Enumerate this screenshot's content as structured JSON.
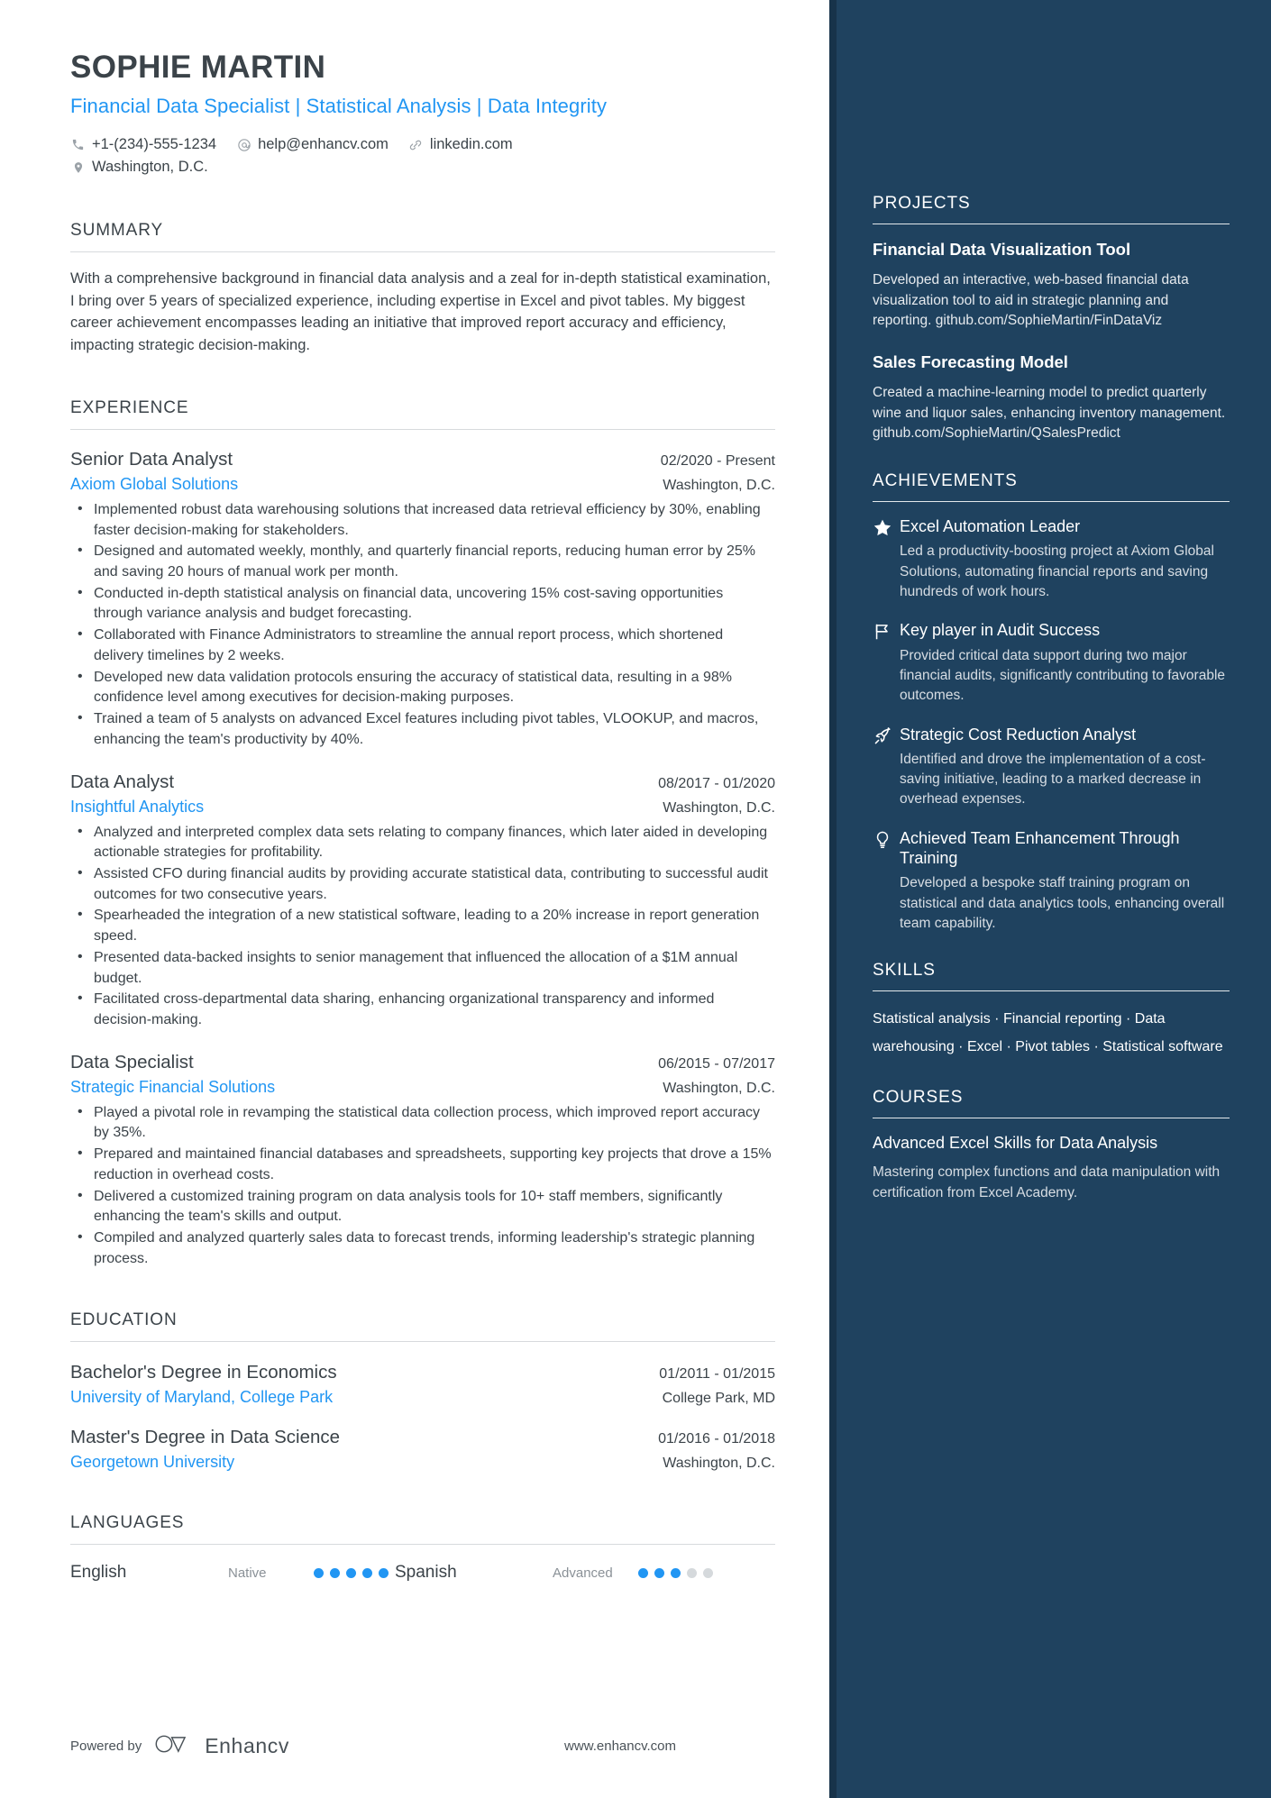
{
  "colors": {
    "accent_blue": "#2196f3",
    "sidebar_bg": "#1f425f",
    "sidebar_stripe": "#17334a",
    "text_dark": "#3b4349"
  },
  "header": {
    "name": "SOPHIE MARTIN",
    "headline": "Financial Data Specialist | Statistical Analysis | Data Integrity",
    "phone": "+1-(234)-555-1234",
    "email": "help@enhancv.com",
    "link": "linkedin.com",
    "location": "Washington, D.C."
  },
  "summary": {
    "title": "SUMMARY",
    "text": "With a comprehensive background in financial data analysis and a zeal for in-depth statistical examination, I bring over 5 years of specialized experience, including expertise in Excel and pivot tables. My biggest career achievement encompasses leading an initiative that improved report accuracy and efficiency, impacting strategic decision-making."
  },
  "experience": {
    "title": "EXPERIENCE",
    "jobs": [
      {
        "role": "Senior Data Analyst",
        "dates": "02/2020 - Present",
        "company": "Axiom Global Solutions",
        "location": "Washington, D.C.",
        "bullets": [
          "Implemented robust data warehousing solutions that increased data retrieval efficiency by 30%, enabling faster decision-making for stakeholders.",
          "Designed and automated weekly, monthly, and quarterly financial reports, reducing human error by 25% and saving 20 hours of manual work per month.",
          "Conducted in-depth statistical analysis on financial data, uncovering 15% cost-saving opportunities through variance analysis and budget forecasting.",
          "Collaborated with Finance Administrators to streamline the annual report process, which shortened delivery timelines by 2 weeks.",
          "Developed new data validation protocols ensuring the accuracy of statistical data, resulting in a 98% confidence level among executives for decision-making purposes.",
          "Trained a team of 5 analysts on advanced Excel features including pivot tables, VLOOKUP, and macros, enhancing the team's productivity by 40%."
        ]
      },
      {
        "role": "Data Analyst",
        "dates": "08/2017 - 01/2020",
        "company": "Insightful Analytics",
        "location": "Washington, D.C.",
        "bullets": [
          "Analyzed and interpreted complex data sets relating to company finances, which later aided in developing actionable strategies for profitability.",
          "Assisted CFO during financial audits by providing accurate statistical data, contributing to successful audit outcomes for two consecutive years.",
          "Spearheaded the integration of a new statistical software, leading to a 20% increase in report generation speed.",
          "Presented data-backed insights to senior management that influenced the allocation of a $1M annual budget.",
          "Facilitated cross-departmental data sharing, enhancing organizational transparency and informed decision-making."
        ]
      },
      {
        "role": "Data Specialist",
        "dates": "06/2015 - 07/2017",
        "company": "Strategic Financial Solutions",
        "location": "Washington, D.C.",
        "bullets": [
          "Played a pivotal role in revamping the statistical data collection process, which improved report accuracy by 35%.",
          "Prepared and maintained financial databases and spreadsheets, supporting key projects that drove a 15% reduction in overhead costs.",
          "Delivered a customized training program on data analysis tools for 10+ staff members, significantly enhancing the team's skills and output.",
          "Compiled and analyzed quarterly sales data to forecast trends, informing leadership's strategic planning process."
        ]
      }
    ]
  },
  "education": {
    "title": "EDUCATION",
    "items": [
      {
        "degree": "Bachelor's Degree in Economics",
        "dates": "01/2011 - 01/2015",
        "school": "University of Maryland, College Park",
        "location": "College Park, MD"
      },
      {
        "degree": "Master's Degree in Data Science",
        "dates": "01/2016 - 01/2018",
        "school": "Georgetown University",
        "location": "Washington, D.C."
      }
    ]
  },
  "languages": {
    "title": "LANGUAGES",
    "items": [
      {
        "name": "English",
        "level": "Native",
        "filled": 5,
        "total": 5
      },
      {
        "name": "Spanish",
        "level": "Advanced",
        "filled": 3,
        "total": 5
      }
    ]
  },
  "footer": {
    "powered_by": "Powered by",
    "brand": "Enhancv",
    "url": "www.enhancv.com"
  },
  "projects": {
    "title": "PROJECTS",
    "items": [
      {
        "name": "Financial Data Visualization Tool",
        "description": "Developed an interactive, web-based financial data visualization tool to aid in strategic planning and reporting. github.com/SophieMartin/FinDataViz"
      },
      {
        "name": "Sales Forecasting Model",
        "description": "Created a machine-learning model to predict quarterly wine and liquor sales, enhancing inventory management. github.com/SophieMartin/QSalesPredict"
      }
    ]
  },
  "achievements": {
    "title": "ACHIEVEMENTS",
    "items": [
      {
        "icon": "star-icon",
        "title": "Excel Automation Leader",
        "description": "Led a productivity-boosting project at Axiom Global Solutions, automating financial reports and saving hundreds of work hours."
      },
      {
        "icon": "flag-icon",
        "title": "Key player in Audit Success",
        "description": "Provided critical data support during two major financial audits, significantly contributing to favorable outcomes."
      },
      {
        "icon": "rocket-icon",
        "title": "Strategic Cost Reduction Analyst",
        "description": "Identified and drove the implementation of a cost-saving initiative, leading to a marked decrease in overhead expenses."
      },
      {
        "icon": "lightbulb-icon",
        "title": "Achieved Team Enhancement Through Training",
        "description": "Developed a bespoke staff training program on statistical and data analytics tools, enhancing overall team capability."
      }
    ]
  },
  "skills": {
    "title": "SKILLS",
    "text": "Statistical analysis · Financial reporting · Data warehousing · Excel · Pivot tables · Statistical software"
  },
  "courses": {
    "title": "COURSES",
    "items": [
      {
        "name": "Advanced Excel Skills for Data Analysis",
        "description": "Mastering complex functions and data manipulation with certification from Excel Academy."
      }
    ]
  }
}
